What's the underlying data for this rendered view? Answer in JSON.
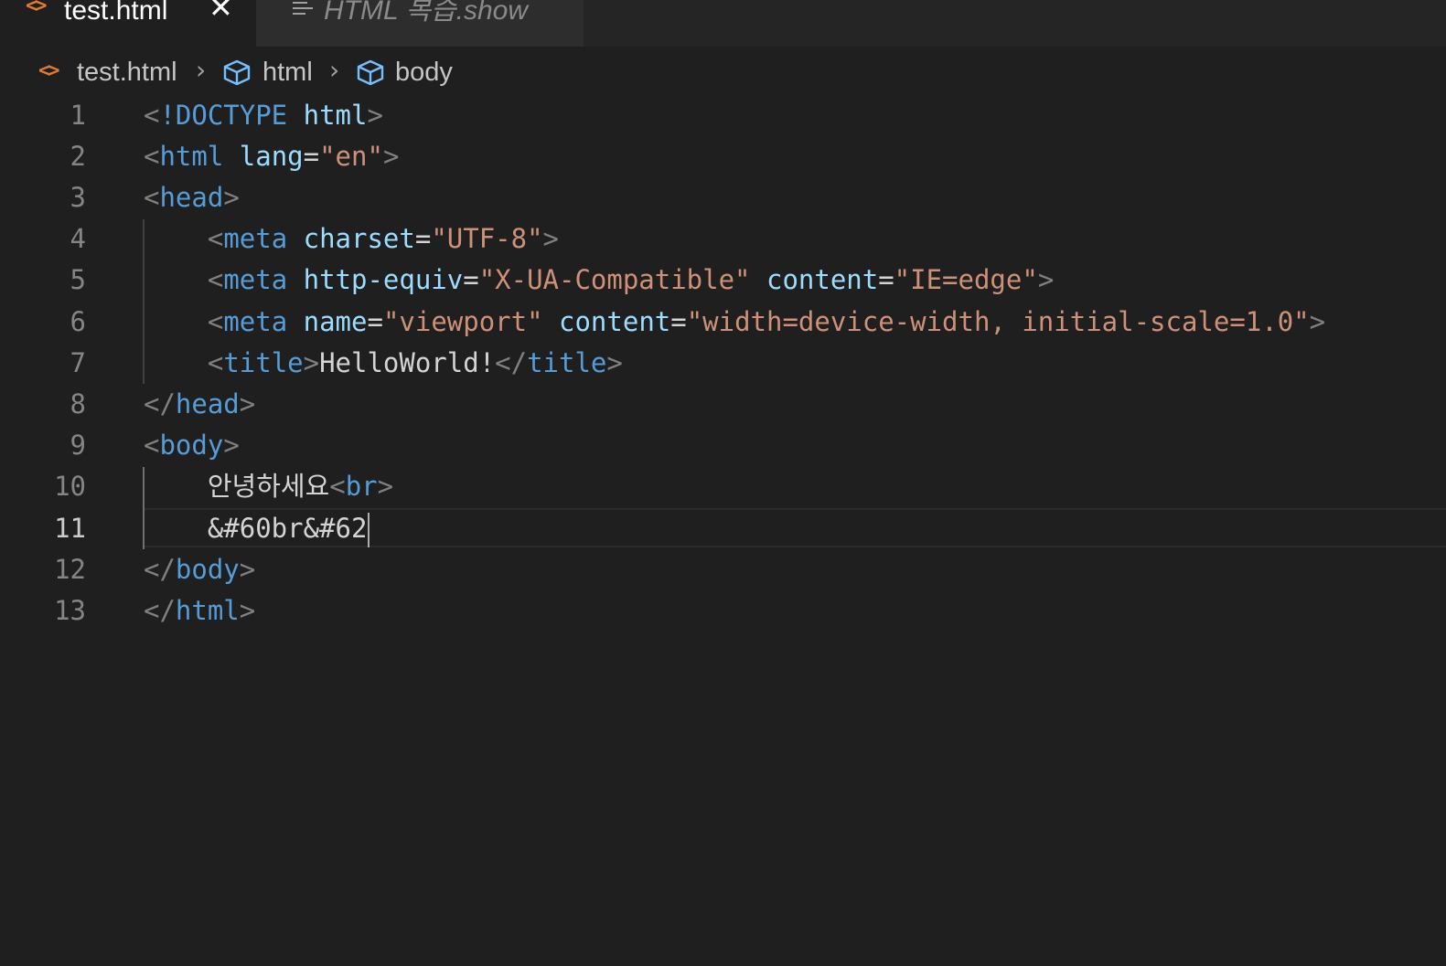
{
  "tabs": [
    {
      "label": "test.html",
      "active": true,
      "icon": "html-file-icon"
    },
    {
      "label": "HTML 복습.show",
      "active": false,
      "icon": "preview-icon"
    }
  ],
  "breadcrumb": {
    "file": "test.html",
    "items": [
      "html",
      "body"
    ]
  },
  "gutter": {
    "line_numbers": [
      "1",
      "2",
      "3",
      "4",
      "5",
      "6",
      "7",
      "8",
      "9",
      "10",
      "11",
      "12",
      "13"
    ],
    "current_line": "11"
  },
  "code": {
    "l1": {
      "open": "<",
      "bang": "!DOCTYPE",
      "sp": " ",
      "kw": "html",
      "close": ">"
    },
    "l2": {
      "open": "<",
      "tag": "html",
      "sp": " ",
      "attr": "lang",
      "eq": "=",
      "val": "\"en\"",
      "close": ">"
    },
    "l3": {
      "open": "<",
      "tag": "head",
      "close": ">"
    },
    "l4": {
      "indent": "    ",
      "open": "<",
      "tag": "meta",
      "sp": " ",
      "attr": "charset",
      "eq": "=",
      "val": "\"UTF-8\"",
      "close": ">"
    },
    "l5": {
      "indent": "    ",
      "open": "<",
      "tag": "meta",
      "sp": " ",
      "attr1": "http-equiv",
      "eq1": "=",
      "val1": "\"X-UA-Compatible\"",
      "sp2": " ",
      "attr2": "content",
      "eq2": "=",
      "val2": "\"IE=edge\"",
      "close": ">"
    },
    "l6": {
      "indent": "    ",
      "open": "<",
      "tag": "meta",
      "sp": " ",
      "attr1": "name",
      "eq1": "=",
      "val1": "\"viewport\"",
      "sp2": " ",
      "attr2": "content",
      "eq2": "=",
      "val2": "\"width=device-width, initial-scale=1.0\"",
      "close": ">"
    },
    "l7": {
      "indent": "    ",
      "open": "<",
      "tag": "title",
      "close": ">",
      "text": "HelloWorld!",
      "open2": "</",
      "tag2": "title",
      "close2": ">"
    },
    "l8": {
      "open": "</",
      "tag": "head",
      "close": ">"
    },
    "l9": {
      "open": "<",
      "tag": "body",
      "close": ">"
    },
    "l10": {
      "indent": "    ",
      "text": "안녕하세요",
      "open": "<",
      "tag": "br",
      "close": ">"
    },
    "l11": {
      "indent": "    ",
      "text": "&#60br&#62"
    },
    "l12": {
      "open": "</",
      "tag": "body",
      "close": ">"
    },
    "l13": {
      "open": "</",
      "tag": "html",
      "close": ">"
    }
  },
  "colors": {
    "background": "#1f1f1f",
    "tag": "#569cd6",
    "attribute": "#9cdcfe",
    "string": "#ce9178",
    "bracket": "#808080",
    "html_icon": "#e37933"
  }
}
